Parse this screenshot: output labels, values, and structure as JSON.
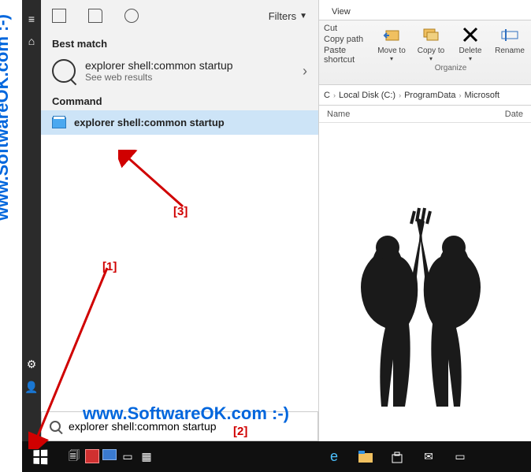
{
  "watermark": "www.SoftwareOK.com :-)",
  "sidebar": {
    "menu": "≡",
    "home": "⌂",
    "settings": "⚙",
    "feedback": "👤"
  },
  "search_panel": {
    "filters_label": "Filters",
    "best_match_label": "Best match",
    "best_match_title": "explorer shell:common startup",
    "best_match_sub": "See web results",
    "command_label": "Command",
    "command_text": "explorer shell:common startup",
    "input_value": "explorer shell:common startup"
  },
  "explorer": {
    "tab": "View",
    "clipboard": {
      "cut": "Cut",
      "copy_path": "Copy path",
      "paste_shortcut": "Paste shortcut"
    },
    "ribbon": {
      "move_to": "Move to",
      "copy_to": "Copy to",
      "delete": "Delete",
      "rename": "Rename",
      "group": "Organize"
    },
    "breadcrumb": [
      "C",
      "Local Disk (C:)",
      "ProgramData",
      "Microsoft"
    ],
    "columns": {
      "name": "Name",
      "date": "Date"
    }
  },
  "annotations": {
    "a1": "[1]",
    "a2": "[2]",
    "a3": "[3]"
  }
}
